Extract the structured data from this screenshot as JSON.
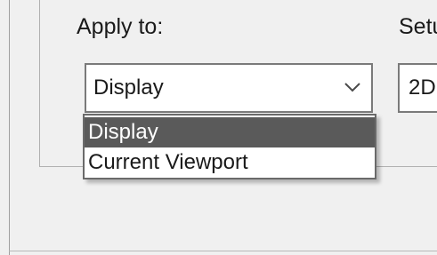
{
  "apply_to": {
    "label": "Apply to:",
    "selected": "Display",
    "options": [
      "Display",
      "Current Viewport"
    ]
  },
  "setup": {
    "label": "Setu",
    "selected": "2D"
  },
  "icons": {
    "dropdown": "chevron-down-icon"
  }
}
